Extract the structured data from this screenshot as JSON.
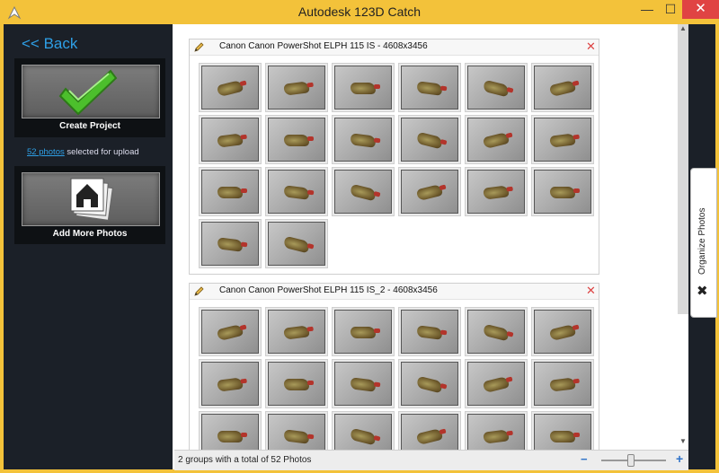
{
  "window": {
    "title": "Autodesk 123D Catch",
    "minimize_glyph": "—",
    "maximize_glyph": "☐",
    "close_glyph": "✕"
  },
  "sidebar": {
    "back_label": "<< Back",
    "create_project_label": "Create Project",
    "photo_count_link": "52 photos",
    "upload_suffix": " selected for upload",
    "add_more_label": "Add More Photos"
  },
  "groups": [
    {
      "title": "Canon Canon PowerShot ELPH 115 IS - 4608x3456",
      "thumb_count_visible": 20
    },
    {
      "title": "Canon Canon PowerShot ELPH 115 IS_2 - 4608x3456",
      "thumb_count_visible": 18
    }
  ],
  "organize_panel": {
    "label": "Organize Photos"
  },
  "status": {
    "summary": "2 groups with a total of 52 Photos",
    "zoom_minus": "−",
    "zoom_plus": "+"
  },
  "colors": {
    "title_bar": "#f3c23a",
    "sidebar_bg": "#1b2028",
    "link_blue": "#2e9fe6",
    "close_red": "#e04343",
    "check_green": "#4cbf2c"
  },
  "icons": {
    "app": "autodesk-logo-icon",
    "create": "green-checkmark-icon",
    "add": "photos-home-icon",
    "edit": "pencil-icon",
    "remove": "red-x-icon",
    "organize": "close-x-icon"
  }
}
